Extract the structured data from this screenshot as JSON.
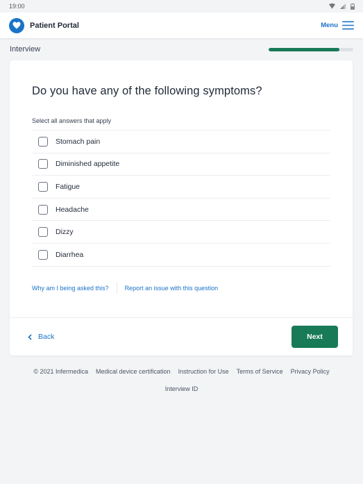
{
  "status_bar": {
    "time": "19:00"
  },
  "header": {
    "brand": "Patient Portal",
    "menu_label": "Menu"
  },
  "progress": {
    "label": "Interview",
    "value_percent": 84
  },
  "question": {
    "title": "Do you have any of the following symptoms?",
    "hint": "Select all answers that apply",
    "options": [
      {
        "label": "Stomach pain",
        "checked": false
      },
      {
        "label": "Diminished appetite",
        "checked": false
      },
      {
        "label": "Fatigue",
        "checked": false
      },
      {
        "label": "Headache",
        "checked": false
      },
      {
        "label": "Dizzy",
        "checked": false
      },
      {
        "label": "Diarrhea",
        "checked": false
      }
    ],
    "why_link": "Why am I being asked this?",
    "report_link": "Report an issue with this question"
  },
  "navigation": {
    "back_label": "Back",
    "next_label": "Next"
  },
  "footer": {
    "links": [
      "© 2021 Infermedica",
      "Medical device certification",
      "Instruction for Use",
      "Terms of Service",
      "Privacy Policy"
    ],
    "interview_id": "Interview ID"
  },
  "colors": {
    "brand_blue": "#1a73c8",
    "primary_green": "#187a56",
    "background": "#f3f4f6"
  }
}
